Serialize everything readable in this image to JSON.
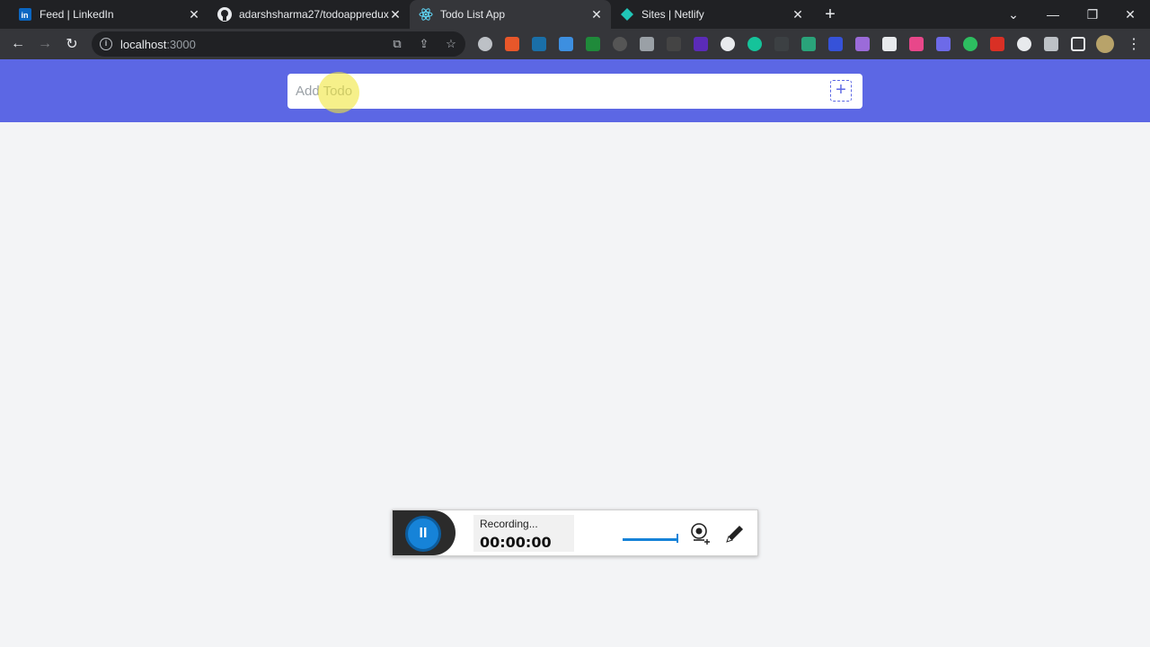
{
  "browser": {
    "tabs": [
      {
        "title": "Feed | LinkedIn",
        "favicon": "linkedin-icon",
        "active": false
      },
      {
        "title": "adarshsharma27/todoappredux",
        "favicon": "github-icon",
        "active": false
      },
      {
        "title": "Todo List App",
        "favicon": "react-icon",
        "active": true
      },
      {
        "title": "Sites | Netlify",
        "favicon": "netlify-icon",
        "active": false
      }
    ],
    "url_host": "localhost",
    "url_port": ":3000"
  },
  "app": {
    "input_placeholder": "Add Todo",
    "header_color": "#5c67e4"
  },
  "recorder": {
    "status": "Recording...",
    "time": "00:00:00"
  }
}
